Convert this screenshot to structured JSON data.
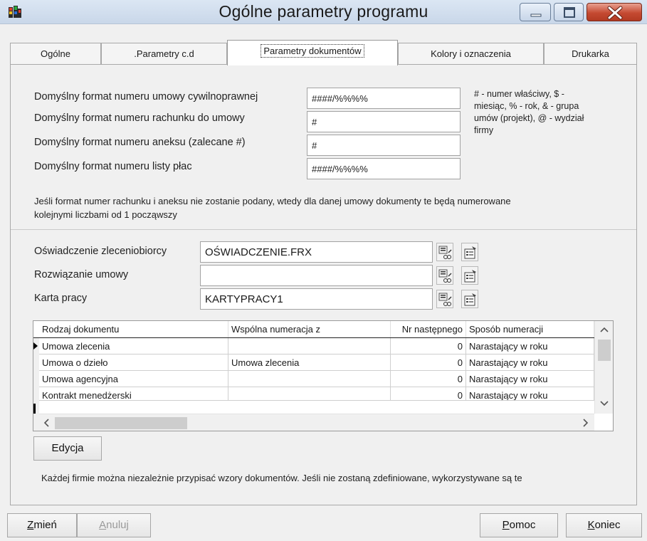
{
  "window": {
    "title": "Ogólne parametry programu"
  },
  "tabs": [
    {
      "label": "Ogólne"
    },
    {
      "label": ".Parametry c.d"
    },
    {
      "label": "Parametry dokumentów"
    },
    {
      "label": "Kolory i oznaczenia"
    },
    {
      "label": "Drukarka"
    }
  ],
  "formats": {
    "contract_label": "Domyślny format numeru umowy cywilnoprawnej",
    "contract_value": "####/%%%%",
    "bill_label": "Domyślny format numeru rachunku do umowy",
    "bill_value": "#",
    "annex_label": "Domyślny format numeru aneksu (zalecane #)",
    "annex_value": "#",
    "payroll_label": "Domyślny format numeru listy płac",
    "payroll_value": "####/%%%%",
    "legend_lines": [
      "# - numer właściwy, $ -",
      "miesiąc, % - rok, & - grupa",
      "umów (projekt), @ - wydział",
      "firmy"
    ],
    "note_lines": [
      "Jeśli format numer rachunku i aneksu nie zostanie podany, wtedy dla danej umowy dokumenty te będą numerowane",
      "kolejnymi liczbami od 1 począwszy"
    ]
  },
  "templates": {
    "rows": [
      {
        "label": "Oświadczenie zleceniobiorcy",
        "value": "OŚWIADCZENIE.FRX"
      },
      {
        "label": "Rozwiązanie umowy",
        "value": ""
      },
      {
        "label": "Karta pracy",
        "value": "KARTYPRACY1"
      }
    ]
  },
  "grid": {
    "columns": [
      "Rodzaj dokumentu",
      "Wspólna numeracja z",
      "Nr następnego",
      "Sposób numeracji"
    ],
    "rows": [
      {
        "type": "Umowa zlecenia",
        "shared": "",
        "next": "0",
        "mode": "Narastający w roku"
      },
      {
        "type": "Umowa o dzieło",
        "shared": "Umowa zlecenia",
        "next": "0",
        "mode": "Narastający w roku"
      },
      {
        "type": "Umowa agencyjna",
        "shared": "",
        "next": "0",
        "mode": "Narastający w roku"
      },
      {
        "type": "Kontrakt menedżerski",
        "shared": "",
        "next": "0",
        "mode": "Narastający w roku"
      }
    ]
  },
  "edit_button": "Edycja",
  "bottom_note": "Każdej firmie można niezależnie przypisać wzory dokumentów. Jeśli nie zostaną zdefiniowane, wykorzystywane są te",
  "footer": {
    "change_first": "Z",
    "change_rest": "mień",
    "cancel_first": "A",
    "cancel_rest": "nuluj",
    "help_first": "P",
    "help_rest": "omoc",
    "end_first": "K",
    "end_rest": "oniec"
  },
  "colors": {
    "close_button": "#c54a32",
    "titlebar": "#c9d7e9"
  }
}
